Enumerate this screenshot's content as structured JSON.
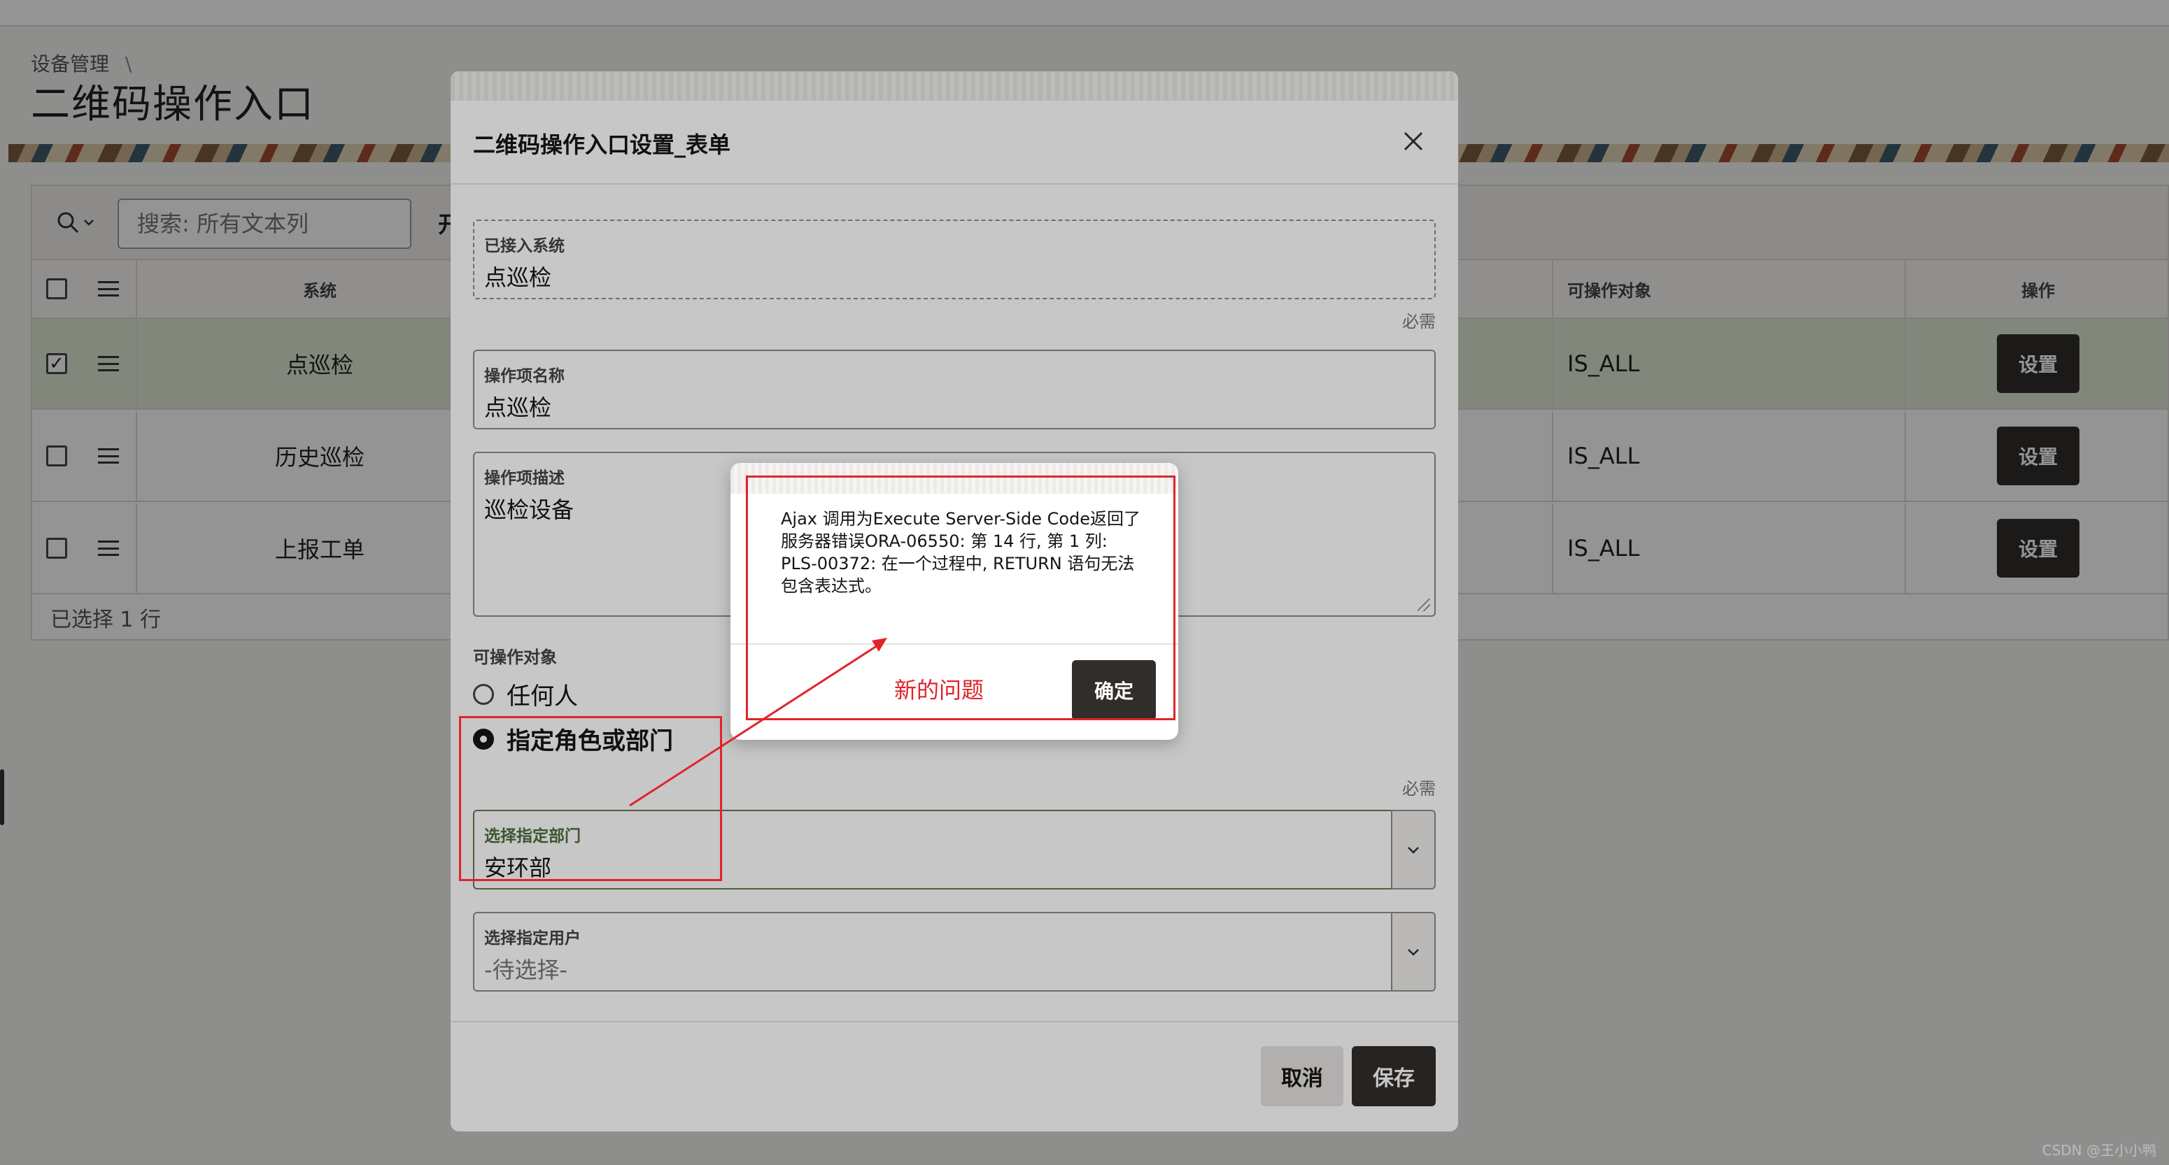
{
  "breadcrumb": {
    "item": "设备管理",
    "separator": "\\"
  },
  "page_title": "二维码操作入口",
  "report": {
    "search_placeholder": "搜索: 所有文本列",
    "toolbar_go": "开",
    "columns": {
      "system": "系统",
      "object": "可操作对象",
      "action": "操作"
    },
    "rows": [
      {
        "system": "点巡检",
        "object": "IS_ALL",
        "action_label": "设置",
        "checked": true
      },
      {
        "system": "历史巡检",
        "object": "IS_ALL",
        "action_label": "设置",
        "checked": false
      },
      {
        "system": "上报工单",
        "object": "IS_ALL",
        "action_label": "设置",
        "checked": false
      }
    ],
    "footer": "已选择 1 行"
  },
  "dialog": {
    "title": "二维码操作入口设置_表单",
    "close_icon": "close-icon",
    "fields": {
      "system": {
        "label": "已接入系统",
        "value": "点巡检",
        "note": "必需"
      },
      "op_name": {
        "label": "操作项名称",
        "value": "点巡检"
      },
      "op_desc": {
        "label": "操作项描述",
        "value": "巡检设备"
      }
    },
    "radio": {
      "label": "可操作对象",
      "options": [
        "任何人",
        "指定角色或部门"
      ],
      "selected": "指定角色或部门",
      "note": "必需"
    },
    "department": {
      "label": "选择指定部门",
      "value": "安环部"
    },
    "user": {
      "label": "选择指定用户",
      "placeholder": "-待选择-"
    },
    "buttons": {
      "cancel": "取消",
      "save": "保存"
    }
  },
  "alert": {
    "lines": [
      "Ajax 调用为Execute Server-Side Code返回了",
      "服务器错误ORA-06550: 第 14 行, 第 1 列:",
      "PLS-00372: 在一个过程中, RETURN 语句无法",
      "包含表达式。"
    ],
    "ok_label": "确定"
  },
  "annotation": {
    "text": "新的问题",
    "color": "#e0242a"
  },
  "watermark": "CSDN @王小小鸭"
}
